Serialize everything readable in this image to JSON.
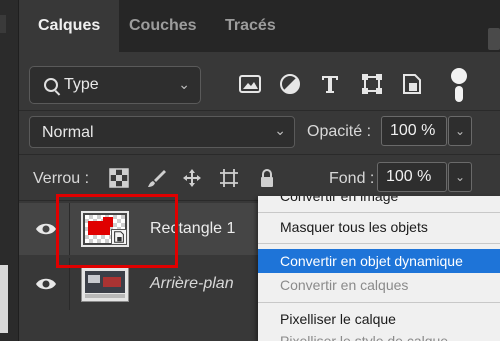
{
  "tabs": [
    {
      "label": "Calques"
    },
    {
      "label": "Couches"
    },
    {
      "label": "Tracés"
    }
  ],
  "filter": {
    "label": "Type"
  },
  "blend": {
    "value": "Normal"
  },
  "opacity": {
    "label": "Opacité :",
    "value": "100 %"
  },
  "lock": {
    "label": "Verrou :"
  },
  "fill": {
    "label": "Fond :",
    "value": "100 %"
  },
  "layers": [
    {
      "name": "Rectangle 1"
    },
    {
      "name": "Arrière-plan"
    }
  ],
  "context_menu": {
    "items": [
      {
        "label": "Convertir en image",
        "disabled": false
      },
      {
        "label": "Masquer tous les objets",
        "disabled": false
      },
      {
        "label": "Convertir en objet dynamique",
        "selected": true
      },
      {
        "label": "Convertir en calques",
        "disabled": true
      },
      {
        "label": "Pixelliser le calque",
        "disabled": false
      },
      {
        "label": "Pixelliser le style de calque",
        "disabled": true
      }
    ]
  },
  "colors": {
    "highlight": "#e00000",
    "menu_selected": "#1e74d8"
  }
}
